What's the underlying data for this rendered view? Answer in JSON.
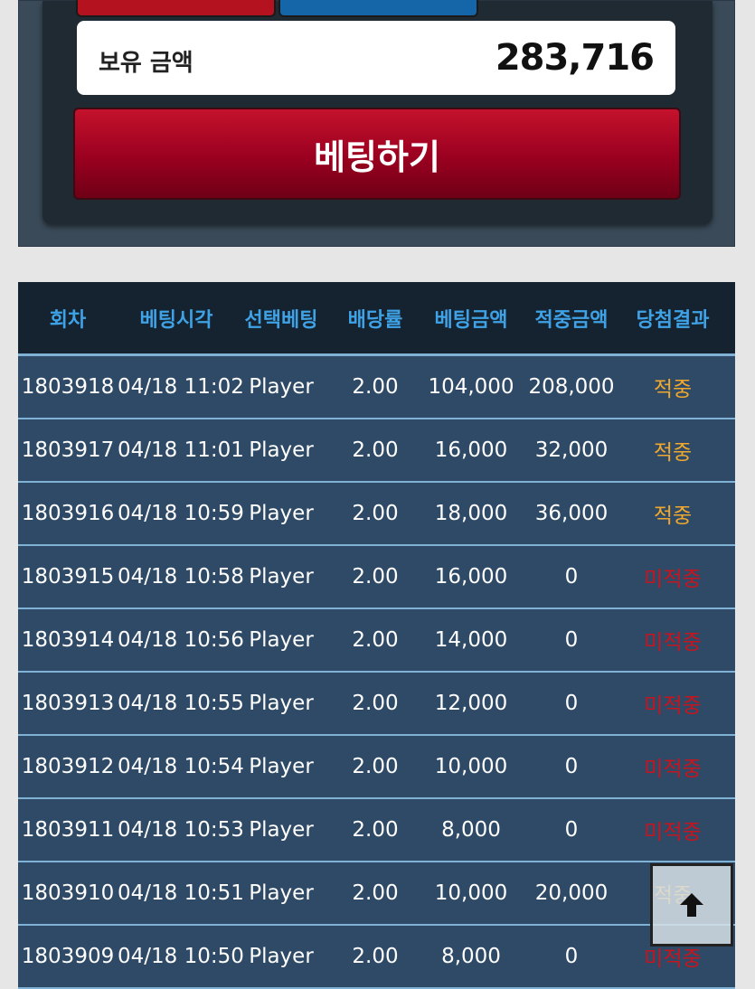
{
  "balance": {
    "label": "보유 금액",
    "value": "283,716"
  },
  "bet_button_label": "베팅하기",
  "colors": {
    "hit": "#f0a82e",
    "miss": "#c8141e",
    "header_text": "#3fa2e6"
  },
  "table": {
    "headers": [
      "회차",
      "베팅시각",
      "선택베팅",
      "배당률",
      "베팅금액",
      "적중금액",
      "당첨결과"
    ],
    "rows": [
      [
        "1803918",
        "04/18 11:02",
        "Player",
        "2.00",
        "104,000",
        "208,000",
        "적중"
      ],
      [
        "1803917",
        "04/18 11:01",
        "Player",
        "2.00",
        "16,000",
        "32,000",
        "적중"
      ],
      [
        "1803916",
        "04/18 10:59",
        "Player",
        "2.00",
        "18,000",
        "36,000",
        "적중"
      ],
      [
        "1803915",
        "04/18 10:58",
        "Player",
        "2.00",
        "16,000",
        "0",
        "미적중"
      ],
      [
        "1803914",
        "04/18 10:56",
        "Player",
        "2.00",
        "14,000",
        "0",
        "미적중"
      ],
      [
        "1803913",
        "04/18 10:55",
        "Player",
        "2.00",
        "12,000",
        "0",
        "미적중"
      ],
      [
        "1803912",
        "04/18 10:54",
        "Player",
        "2.00",
        "10,000",
        "0",
        "미적중"
      ],
      [
        "1803911",
        "04/18 10:53",
        "Player",
        "2.00",
        "8,000",
        "0",
        "미적중"
      ],
      [
        "1803910",
        "04/18 10:51",
        "Player",
        "2.00",
        "10,000",
        "20,000",
        "적중"
      ],
      [
        "1803909",
        "04/18 10:50",
        "Player",
        "2.00",
        "8,000",
        "0",
        "미적중"
      ]
    ]
  },
  "scroll_top_icon": "arrow-up-icon"
}
